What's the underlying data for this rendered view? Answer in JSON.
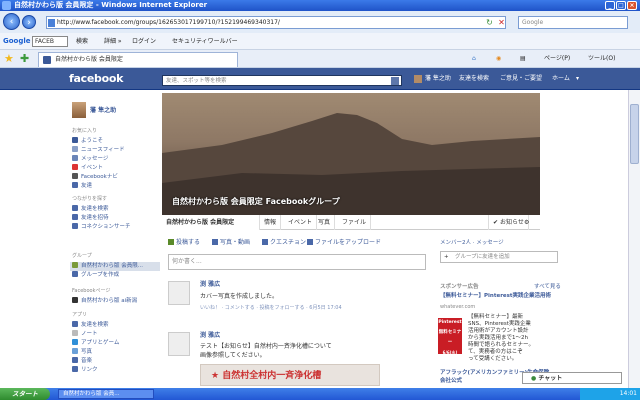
{
  "window": {
    "title": "自然村かわら版 会員限定 - Windows Internet Explorer"
  },
  "address": {
    "url": "http://www.facebook.com/groups/162653017199710/?152199469340317/",
    "search_placeholder": "Google"
  },
  "gtoolbar": {
    "logo": "Google",
    "field": "FACEB",
    "items": [
      "検索",
      "詳細 »",
      "ログイン",
      "セキュリティワールバー"
    ]
  },
  "tab": {
    "title": "自然村かわら版 会員限定"
  },
  "tools": [
    "ページ(P)",
    "ツール(O)"
  ],
  "fb": {
    "logo": "facebook",
    "search_placeholder": "友達、スポット等を検索",
    "nav": [
      "藩 隼之助",
      "友達を検索",
      "ご意見・ご要望",
      "ホーム"
    ]
  },
  "left": {
    "profile_name": "藩 隼之助",
    "sections": {
      "fav": "お気に入り",
      "friends": "つながりを探す",
      "groups": "グループ",
      "pages": "Facebookページ",
      "apps": "アプリ"
    },
    "fav": [
      "ようこそ",
      "ニュースフィード",
      "メッセージ",
      "イベント",
      "Facebookナビ",
      "友達"
    ],
    "find": [
      "友達を検索",
      "友達を招待",
      "コネクションサーチ"
    ],
    "groups": [
      "自然村かわら版 会員限...",
      "グループを作成"
    ],
    "pages": [
      "自然村かわら版 ai新潟"
    ],
    "apps": [
      "友達を検索",
      "ノート",
      "アプリとゲーム",
      "写真",
      "音楽",
      "リンク"
    ]
  },
  "cover": {
    "title": "自然村かわら版 会員限定 Facebookグループ"
  },
  "group_tabs": [
    "自然村かわら版 会員限定",
    "情報",
    "イベント",
    "写真",
    "ファイル"
  ],
  "group_actions": {
    "notify": "お知らせ"
  },
  "composer": {
    "actions": [
      "投稿する",
      "写真・動画",
      "クエスチョン",
      "ファイルをアップロード"
    ],
    "placeholder": "何か書く..."
  },
  "posts": [
    {
      "author": "渕 雅広",
      "text": [
        "カバー写真を作成しました。"
      ],
      "meta": "いいね！ · コメントする · 投稿をフォローする · 6月5日 17:04"
    },
    {
      "author": "渕 雅広",
      "text": [
        "テスト【お知らせ】自然村内一斉浄化槽について",
        "画像参照してください。"
      ],
      "meta": ""
    }
  ],
  "banner": {
    "text": "★ 自然村全村内一斉浄化槽"
  },
  "right": {
    "members": "メンバー2人 · メッセージ",
    "add_friends": "グループに友達を追加",
    "ads_title": "スポンサー広告",
    "ads_more": "すべて見る",
    "ad_head": "【無料セミナー】Pinterest実践企業活用術",
    "ad_site": "whatever.com",
    "ad_body": [
      "【無料セミナー】最新",
      "SNS、Pinterest実践企業",
      "活用術がアカウント設計",
      "から実践活用まで1〜2h",
      "時間で語られるセミナー。",
      "て、実務者の方はこぞ",
      "って受講ください。"
    ],
    "ad2_head": "アフラック(アメリカンファミリー)生命保険",
    "ad2_sub": "会社公式"
  },
  "pin": {
    "brand": "Pinterest",
    "line1": "無料セミナー",
    "line2": "6/6(水) 15:30〜"
  },
  "chat": {
    "label": "チャット"
  },
  "taskbar": {
    "start": "スタート",
    "task": "自然村かわら版 会員...",
    "clock": "14:01"
  }
}
